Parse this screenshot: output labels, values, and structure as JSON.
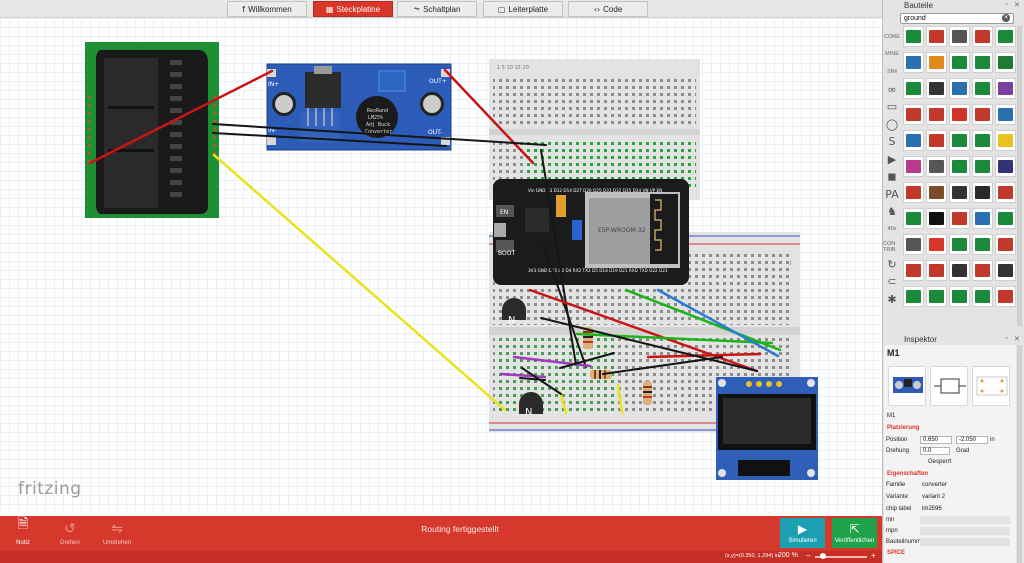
{
  "tabs": [
    {
      "label": "Willkommen",
      "icon": "fritzing-f-icon",
      "glyph": "f",
      "active": false
    },
    {
      "label": "Steckplatine",
      "icon": "breadboard-icon",
      "glyph": "▦",
      "active": true
    },
    {
      "label": "Schaltplan",
      "icon": "schematic-icon",
      "glyph": "⏦",
      "active": false
    },
    {
      "label": "Leiterplatte",
      "icon": "pcb-icon",
      "glyph": "▢",
      "active": false
    },
    {
      "label": "Code",
      "icon": "code-icon",
      "glyph": "‹›",
      "active": false
    }
  ],
  "canvas": {
    "logo": "fritzing",
    "parts": {
      "stepdown_top_left": "IN+",
      "stepdown_top_right": "OUT+",
      "stepdown_bottom_left": "IN-",
      "stepdown_bottom_right": "OUT-",
      "stepdown_chip": "ReoRand",
      "stepdown_chip_2": "LM25%",
      "stepdown_chip_3": "Adj Buck",
      "stepdown_chip_4": "Converter",
      "esp32_en": "EN",
      "esp32_boot": "BOOT",
      "esp32_top_pins": "Vin GND 13 D12 D14 D27 D26 D25 D33 D32 D35 D34 VN VP EN",
      "esp32_bottom_pins": "3V3 GND D15 D2 D4 RX2 TX2 D5 D18 D19 D21 RXD TXD D22 D23",
      "transistor_1": "N",
      "transistor_2": "N",
      "breadboard_col_top": "1 5 10 15 20",
      "breadboard_row_j": "J"
    }
  },
  "toolbar": {
    "note": {
      "label": "Notiz",
      "icon": "note-icon",
      "glyph": "🗎"
    },
    "rotate": {
      "label": "Drehen",
      "icon": "rotate-icon",
      "glyph": "↺"
    },
    "flip": {
      "label": "Umdrehen",
      "icon": "flip-icon",
      "glyph": "⇋"
    },
    "status": "Routing fertiggestellt",
    "simulate": {
      "label": "Simulieren",
      "icon": "play-icon",
      "glyph": "▶",
      "color": "#1aa0b0"
    },
    "share": {
      "label": "Veröffentlichen",
      "icon": "share-icon",
      "glyph": "⇱",
      "color": "#1fa24a"
    }
  },
  "statusbar": {
    "coords": "(x,y)=(0.350, 1.294) in",
    "zoom": "200 %",
    "zoom_minus": "–",
    "zoom_plus": "+",
    "zoom_level": 0.15
  },
  "parts_bin": {
    "title": "Bauteile",
    "search_value": "ground",
    "bins": [
      "CORE",
      "MINE",
      "SIM",
      "∞",
      "▭",
      "◯",
      "S",
      "▶",
      "◼",
      "PA",
      "♞",
      "40x",
      "CON TRIB",
      "↻",
      "⊂",
      "✱"
    ],
    "tile_colors": [
      "#1a8a3a",
      "#c0392b",
      "#555555",
      "#c0392b",
      "#1a8a3a",
      "#2a6fb0",
      "#e08a1e",
      "#1a8a3a",
      "#1a8a3a",
      "#1f7a35",
      "#1a8a3a",
      "#333333",
      "#2a6fb0",
      "#1a8a3a",
      "#7b3fa0",
      "#c0392b",
      "#c0392b",
      "#d1332a",
      "#c0392b",
      "#2a6fb0",
      "#2a6fb0",
      "#c0392b",
      "#1a8a3a",
      "#1a8a3a",
      "#e8c21e",
      "#b83a8a",
      "#555555",
      "#1a8a3a",
      "#1a8a3a",
      "#333377",
      "#c0392b",
      "#7a4c2a",
      "#333333",
      "#2a2a2a",
      "#c0392b",
      "#1a8a3a",
      "#111111",
      "#c0392b",
      "#2a6fb0",
      "#1a8a3a",
      "#555555",
      "#d9362a",
      "#1a8a3a",
      "#1a8a3a",
      "#c0392b",
      "#c0392b",
      "#c0392b",
      "#333333",
      "#c0392b",
      "#333333",
      "#1a8a3a",
      "#1a8a3a",
      "#1a8a3a",
      "#1a8a3a",
      "#c0392b"
    ]
  },
  "inspector": {
    "title": "Inspektor",
    "name": "M1",
    "id": "M1",
    "placement_header": "Platzierung",
    "position_label": "Position",
    "position_x": "0.650",
    "position_y": "-2.050",
    "position_unit": "in",
    "rotation_label": "Drehung",
    "rotation_value": "0.0",
    "rotation_unit": "Grad",
    "locked": "Gesperrt",
    "properties_header": "Eigenschaften",
    "family_label": "Familie",
    "family_value": "converter",
    "variant_label": "Variante",
    "variant_value": "variant 2",
    "chip_label": "chip label",
    "chip_value": "lm2596",
    "mn_label": "mn",
    "mpn_label": "mpn",
    "part_number_label": "Bauteilnumm",
    "spice_header": "SPICE"
  }
}
